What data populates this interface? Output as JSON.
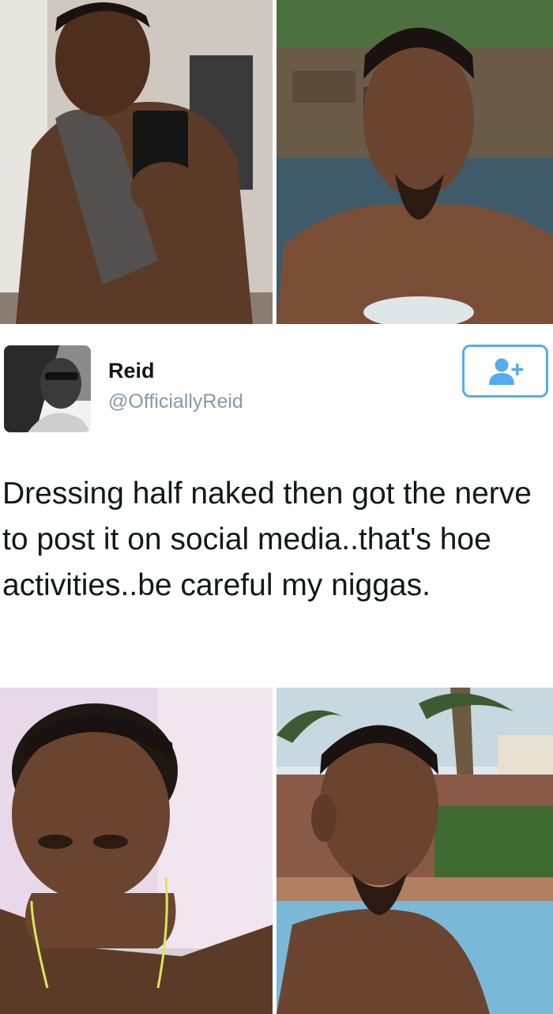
{
  "tweet": {
    "display_name": "Reid",
    "handle": "@OfficiallyReid",
    "text": "Dressing half naked then got the nerve to post it on social media..that's hoe activities..be careful my niggas.",
    "follow_icon": "add-user-icon"
  },
  "photos": [
    {
      "name": "mirror-selfie-photo",
      "subject": "shirtless mirror selfie holding phone"
    },
    {
      "name": "pool-selfie-photo",
      "subject": "selfie in hot tub by rocks"
    },
    {
      "name": "lying-down-selfie-photo",
      "subject": "selfie lying down with earphones"
    },
    {
      "name": "outdoor-pool-photo",
      "subject": "selfie in pool with palm trees"
    }
  ],
  "colors": {
    "accent": "#55acee",
    "handle": "#8899a6",
    "text": "#14171a"
  }
}
